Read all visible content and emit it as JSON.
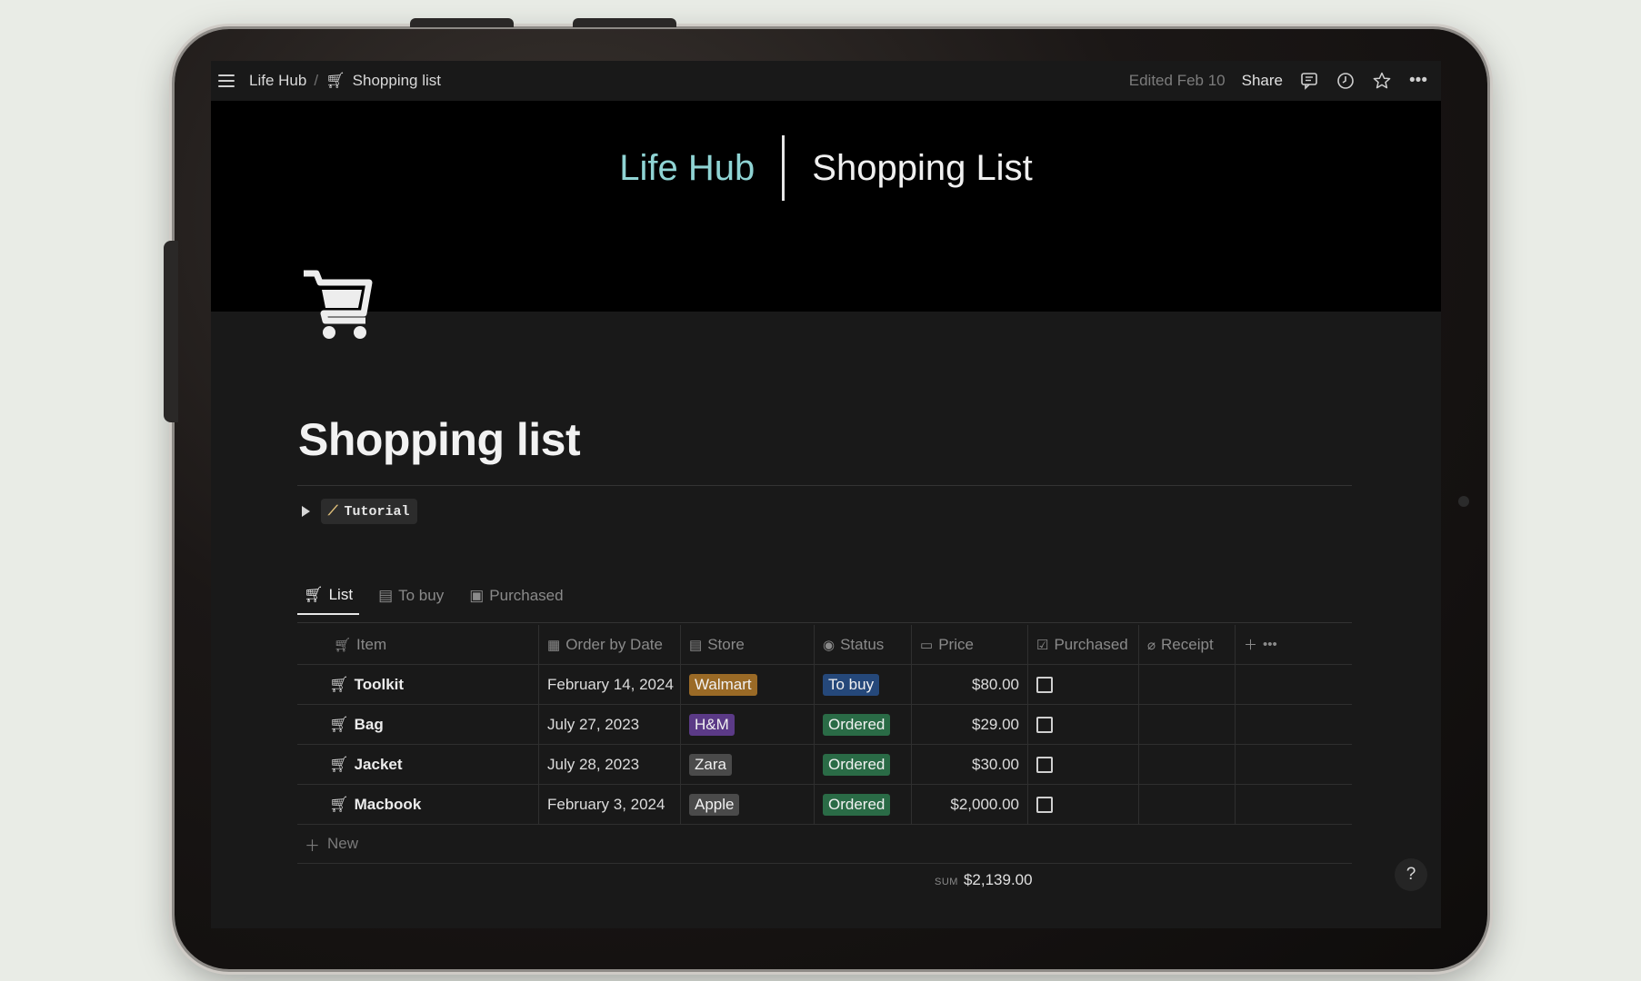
{
  "topbar": {
    "breadcrumb_root": "Life Hub",
    "breadcrumb_sep": "/",
    "breadcrumb_page": "Shopping list",
    "edited": "Edited Feb 10",
    "share": "Share"
  },
  "cover": {
    "brand": "Life Hub",
    "title": "Shopping List"
  },
  "page": {
    "title": "Shopping list",
    "toggle_label": "Tutorial"
  },
  "views": [
    {
      "label": "List",
      "icon": "cart-icon"
    },
    {
      "label": "To buy",
      "icon": "store-icon"
    },
    {
      "label": "Purchased",
      "icon": "archive-icon"
    }
  ],
  "table": {
    "columns": [
      "Item",
      "Order by Date",
      "Store",
      "Status",
      "Price",
      "Purchased",
      "Receipt"
    ],
    "rows": [
      {
        "item": "Toolkit",
        "date": "February 14, 2024",
        "store": "Walmart",
        "status": "To buy",
        "price": "$80.00",
        "purchased": false
      },
      {
        "item": "Bag",
        "date": "July 27, 2023",
        "store": "H&M",
        "status": "Ordered",
        "price": "$29.00",
        "purchased": false
      },
      {
        "item": "Jacket",
        "date": "July 28, 2023",
        "store": "Zara",
        "status": "Ordered",
        "price": "$30.00",
        "purchased": false
      },
      {
        "item": "Macbook",
        "date": "February 3, 2024",
        "store": "Apple",
        "status": "Ordered",
        "price": "$2,000.00",
        "purchased": false
      }
    ],
    "new_label": "New",
    "sum_label": "SUM",
    "sum_value": "$2,139.00"
  },
  "colors": {
    "walmart": "#9a6a26",
    "hm": "#5b3a87",
    "zara": "#4a4a4a",
    "apple": "#4a4a4a",
    "to_buy": "#25487a",
    "ordered": "#2a6b46",
    "accent": "#8fd4d4"
  },
  "help": "?"
}
